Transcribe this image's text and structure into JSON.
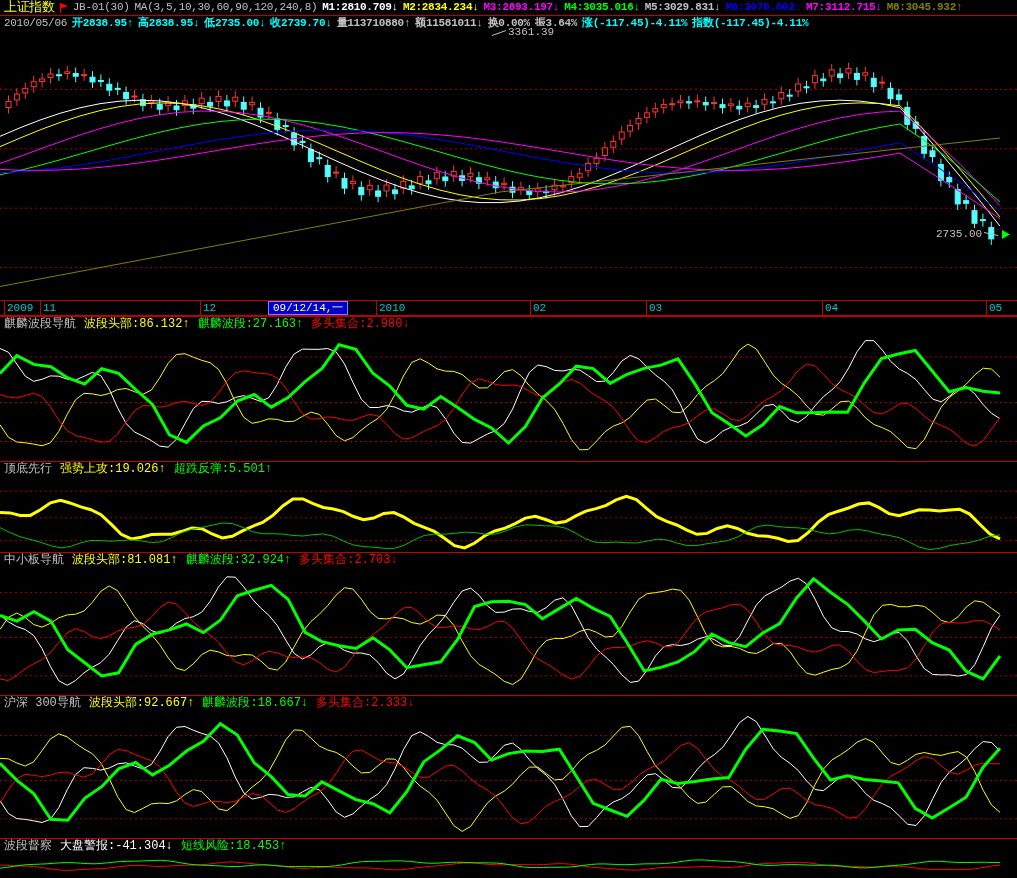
{
  "header": {
    "title": "上证指数",
    "indicator": "JB-01(30)",
    "ma_params": "MA(3,5,10,30,60,90,120,240,8)",
    "ma_items": [
      {
        "label": "M1:2810.709",
        "arrow": "↓",
        "color": "#ffffff"
      },
      {
        "label": "M2:2834.234",
        "arrow": "↓",
        "color": "#ffff00"
      },
      {
        "label": "M3:2893.197",
        "arrow": "↓",
        "color": "#ff00ff"
      },
      {
        "label": "M4:3035.016",
        "arrow": "↓",
        "color": "#00ff00"
      },
      {
        "label": "M5:3029.831",
        "arrow": "↓",
        "color": "#c0c0c0"
      },
      {
        "label": "M6:3070.002",
        "arrow": "↓",
        "color": "#0000ff"
      },
      {
        "label": "M7:3112.715",
        "arrow": "↓",
        "color": "#ff00ff"
      },
      {
        "label": "M8:3045.932",
        "arrow": "↑",
        "color": "#808000"
      }
    ]
  },
  "quote": {
    "date": "2010/05/06",
    "items": [
      {
        "label": "开2838.95",
        "arrow": "↑",
        "color": "#00ffff"
      },
      {
        "label": "高2838.95",
        "arrow": "↓",
        "color": "#00ffff"
      },
      {
        "label": "低2735.00",
        "arrow": "↓",
        "color": "#00ffff"
      },
      {
        "label": "收2739.70",
        "arrow": "↓",
        "color": "#00ffff"
      },
      {
        "label": "量113710880",
        "arrow": "↑",
        "color": "#c0c0c0"
      },
      {
        "label": "额11581011",
        "arrow": "↓",
        "color": "#c0c0c0"
      },
      {
        "label": "换0.00%",
        "color": "#c0c0c0"
      },
      {
        "label": "振3.64%",
        "color": "#c0c0c0"
      },
      {
        "label": "涨(-117.45)-4.11%",
        "color": "#00ffff"
      },
      {
        "label": "指数(-117.45)-4.11%",
        "color": "#00ffff"
      }
    ]
  },
  "price_chart": {
    "high_label": "3361.39",
    "low_label": "2735.00"
  },
  "time_axis": [
    {
      "label": "2009",
      "selected": false
    },
    {
      "label": "11",
      "selected": false
    },
    {
      "label": "12",
      "selected": false
    },
    {
      "label": "09/12/14,一",
      "selected": true
    },
    {
      "label": "2010",
      "selected": false
    },
    {
      "label": "02",
      "selected": false
    },
    {
      "label": "03",
      "selected": false
    },
    {
      "label": "04",
      "selected": false
    },
    {
      "label": "05",
      "selected": false
    }
  ],
  "panels": [
    {
      "name": "麒麟波段导航",
      "items": [
        {
          "label": "波段头部:86.132",
          "arrow": "↑",
          "color": "#ffff00"
        },
        {
          "label": "麒麟波段:27.163",
          "arrow": "↑",
          "color": "#00ff00"
        },
        {
          "label": "多头集合:2.980",
          "arrow": "↓",
          "color": "#ff0000"
        }
      ]
    },
    {
      "name": "顶底先行",
      "items": [
        {
          "label": "强势上攻:19.026",
          "arrow": "↑",
          "color": "#ffff00"
        },
        {
          "label": "超跌反弹:5.501",
          "arrow": "↑",
          "color": "#00ff00"
        }
      ]
    },
    {
      "name": "中小板导航",
      "items": [
        {
          "label": "波段头部:81.081",
          "arrow": "↑",
          "color": "#ffff00"
        },
        {
          "label": "麒麟波段:32.924",
          "arrow": "↑",
          "color": "#00ff00"
        },
        {
          "label": "多头集合:2.703",
          "arrow": "↓",
          "color": "#ff0000"
        }
      ]
    },
    {
      "name": "沪深 300导航",
      "items": [
        {
          "label": "波段头部:92.667",
          "arrow": "↑",
          "color": "#ffff00"
        },
        {
          "label": "麒麟波段:18.667",
          "arrow": "↓",
          "color": "#00ff00"
        },
        {
          "label": "多头集合:2.333",
          "arrow": "↓",
          "color": "#ff0000"
        }
      ]
    },
    {
      "name": "波段督察",
      "items": [
        {
          "label": "大盘警报:-41.304",
          "arrow": "↓",
          "color": "#ffffff"
        },
        {
          "label": "短线风险:18.453",
          "arrow": "↑",
          "color": "#00ff00"
        }
      ]
    }
  ]
}
